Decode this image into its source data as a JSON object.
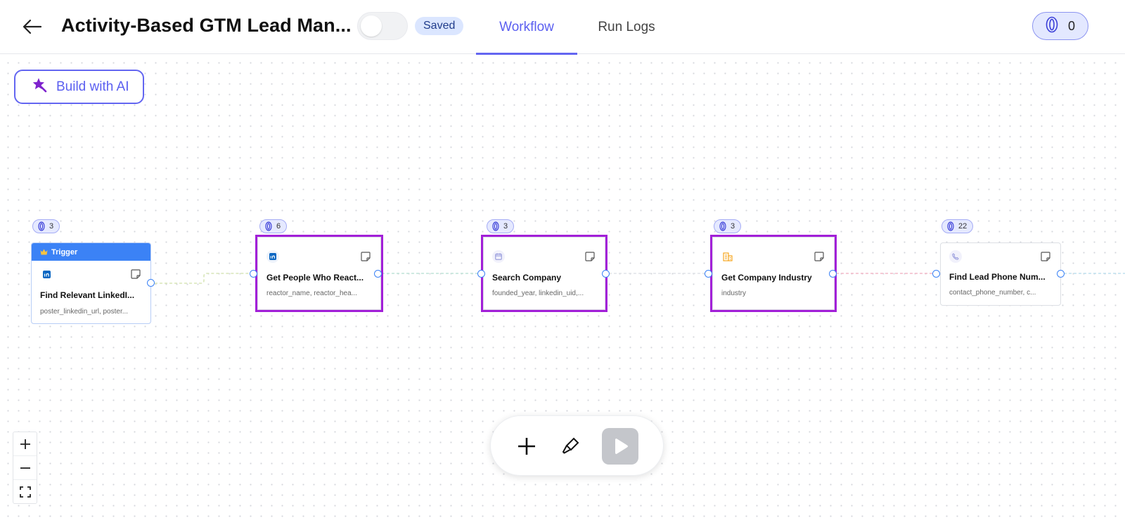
{
  "header": {
    "title": "Activity-Based GTM Lead Man...",
    "status": "Saved",
    "tabs": [
      {
        "label": "Workflow",
        "active": true
      },
      {
        "label": "Run Logs",
        "active": false
      }
    ],
    "credits": "0"
  },
  "canvas": {
    "build_ai_label": "Build with AI",
    "nodes": [
      {
        "cost": "3",
        "header": "Trigger",
        "name": "Find Relevant LinkedI...",
        "fields": "poster_linkedin_url, poster...",
        "icon": "linkedin-icon"
      },
      {
        "cost": "6",
        "name": "Get People Who React...",
        "fields": "reactor_name, reactor_hea...",
        "icon": "linkedin-icon"
      },
      {
        "cost": "3",
        "name": "Search Company",
        "fields": "founded_year, linkedin_uid,...",
        "icon": "calendar-icon"
      },
      {
        "cost": "3",
        "name": "Get Company Industry",
        "fields": "industry",
        "icon": "building-icon"
      },
      {
        "cost": "22",
        "name": "Find Lead Phone Num...",
        "fields": "contact_phone_number, c...",
        "icon": "phone-icon"
      }
    ]
  },
  "colors": {
    "accent": "#6366f1",
    "highlight": "#a21fd8",
    "trigger": "#3b82f6"
  }
}
